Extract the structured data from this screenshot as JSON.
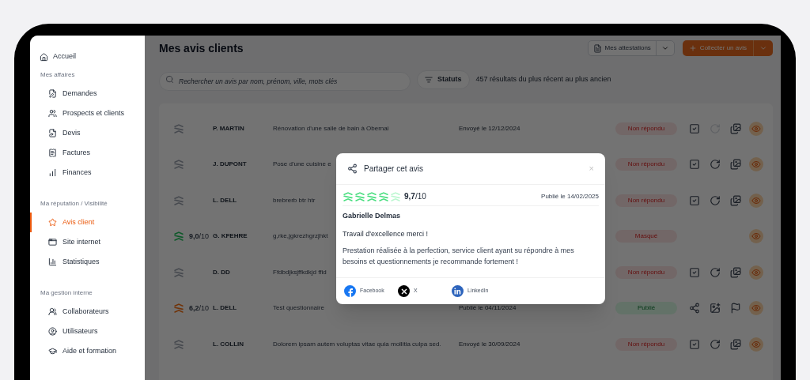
{
  "sidebar": {
    "home": {
      "label": "Accueil",
      "selected": false
    },
    "sections": [
      {
        "title": "Mes affaires",
        "items": [
          {
            "label": "Demandes",
            "selected": false
          },
          {
            "label": "Prospects et clients",
            "selected": false
          },
          {
            "label": "Devis",
            "selected": false
          },
          {
            "label": "Factures",
            "selected": false
          },
          {
            "label": "Finances",
            "selected": false
          }
        ]
      },
      {
        "title": "Ma réputation / Visibilité",
        "items": [
          {
            "label": "Avis client",
            "selected": true
          },
          {
            "label": "Site internet",
            "selected": false
          },
          {
            "label": "Statistiques",
            "selected": false
          }
        ]
      },
      {
        "title": "Ma gestion interne",
        "items": [
          {
            "label": "Collaborateurs",
            "selected": false
          },
          {
            "label": "Utilisateurs",
            "selected": false
          },
          {
            "label": "Aide et formation",
            "selected": false
          }
        ]
      }
    ]
  },
  "header": {
    "title": "Mes avis clients",
    "attestations_button": "Mes attestations",
    "collect_button": "Collecter un avis"
  },
  "toolbar": {
    "search": {
      "placeholder": "Rechercher un avis par nom, prénom, ville, mots clés"
    },
    "filter_button": "Statuts",
    "results": "457 résultats du plus récent au plus ancien"
  },
  "rows": [
    {
      "kind": "unrated",
      "name": "P. MARTIN",
      "subject": "Rénovation d'une salle de bain à Obernai",
      "date": "Envoyé le 12/12/2024",
      "status": {
        "label": "Non répondu",
        "kind": "pending"
      },
      "actions": [
        {
          "kind": "respond",
          "disabled": false
        },
        {
          "kind": "remind",
          "disabled": true
        },
        {
          "kind": "photos",
          "disabled": false
        },
        {
          "kind": "view",
          "disabled": false
        }
      ]
    },
    {
      "kind": "unrated",
      "name": "J. DUPONT",
      "subject": "Pose d'une cuisine e",
      "status": {
        "label": "Non répondu",
        "kind": "pending"
      },
      "actions": [
        {
          "kind": "respond",
          "disabled": false
        },
        {
          "kind": "remind",
          "disabled": false
        },
        {
          "kind": "photos",
          "disabled": false
        },
        {
          "kind": "view",
          "disabled": false
        }
      ]
    },
    {
      "kind": "unrated",
      "name": "L. DELL",
      "subject": "brebrerb btr htr",
      "status": {
        "label": "Non répondu",
        "kind": "pending"
      },
      "actions": [
        {
          "kind": "respond",
          "disabled": false
        },
        {
          "kind": "remind",
          "disabled": false
        },
        {
          "kind": "photos",
          "disabled": false
        },
        {
          "kind": "view",
          "disabled": false
        }
      ]
    },
    {
      "kind": "good",
      "score": "**9,0**/10",
      "name": "G. KFEHRE",
      "subject": "g,rke,jgkrezhgrzjhkt",
      "status": {
        "label": "Masqué",
        "kind": "hidden"
      },
      "actions": [
        {
          "kind": "view",
          "disabled": false
        }
      ]
    },
    {
      "kind": "unrated",
      "name": "D. DD",
      "subject": "Ffdbdjksjffkdkjd ffid",
      "status": {
        "label": "Non répondu",
        "kind": "pending"
      },
      "actions": [
        {
          "kind": "respond",
          "disabled": false
        },
        {
          "kind": "remind",
          "disabled": false
        },
        {
          "kind": "photos",
          "disabled": false
        },
        {
          "kind": "view",
          "disabled": false
        }
      ]
    },
    {
      "kind": "average",
      "score": "**6,2**/10",
      "name": "L. DELL",
      "subject": "Test questionnaire",
      "date": "Publié le 04/11/2024",
      "status": {
        "label": "Publié",
        "kind": "published"
      },
      "actions": [
        {
          "kind": "share",
          "disabled": false
        },
        {
          "kind": "image",
          "disabled": false
        },
        {
          "kind": "flag",
          "disabled": false
        },
        {
          "kind": "view",
          "disabled": false
        }
      ]
    },
    {
      "kind": "unrated",
      "name": "L. COLLIN",
      "subject": "Dolorem ipsam autem voluptas vitae quia mollitia culpa sed.",
      "date": "Envoyé le 30/09/2024",
      "status": {
        "label": "Non répondu",
        "kind": "pending"
      },
      "actions": [
        {
          "kind": "respond",
          "disabled": false
        },
        {
          "kind": "remind",
          "disabled": false
        },
        {
          "kind": "photos",
          "disabled": false
        },
        {
          "kind": "view",
          "disabled": false
        }
      ]
    }
  ],
  "modal": {
    "title": "Partager cet avis",
    "close": "×",
    "stars": 4,
    "score": "**9,7**/10",
    "published": "Publié le 14/02/2025",
    "author": "Gabrielle Delmas",
    "review_title": "Travail d'excellence merci !",
    "review_body": "Prestation réalisée à la perfection, service client ayant su répondre à mes besoins et questionnements je recommande fortement !",
    "share_links": [
      {
        "kind": "facebook",
        "label": "Facebook"
      },
      {
        "kind": "x",
        "label": "X"
      },
      {
        "kind": "linkedin",
        "label": "LinkedIn"
      }
    ]
  }
}
